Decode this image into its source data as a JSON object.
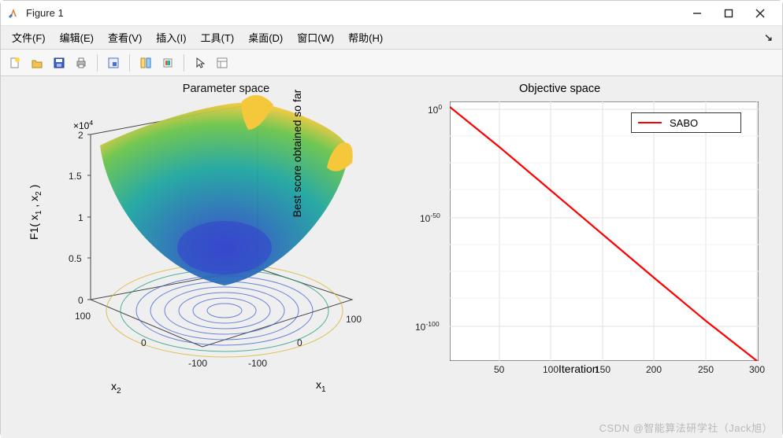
{
  "window": {
    "title": "Figure 1",
    "min_tip": "Minimize",
    "max_tip": "Maximize",
    "close_tip": "Close"
  },
  "menu": {
    "file": "文件(F)",
    "edit": "编辑(E)",
    "view": "查看(V)",
    "insert": "插入(I)",
    "tools": "工具(T)",
    "desktop": "桌面(D)",
    "window": "窗口(W)",
    "help": "帮助(H)"
  },
  "toolbar": {
    "new": "New Figure",
    "open": "Open",
    "save": "Save",
    "print": "Print",
    "data_cursor": "Data Cursor",
    "link": "Link Plot",
    "colorbar": "Insert Colorbar",
    "legend": "Insert Legend",
    "edit_plot": "Edit Plot",
    "open_pe": "Open Property Inspector"
  },
  "chart_data": [
    {
      "type": "surface3d",
      "title": "Parameter space",
      "z_exponent_label": "×10^4",
      "zlabel": "F1( x_1 , x_2 )",
      "xlabel": "x_1",
      "ylabel": "x_2",
      "x_range": [
        -100,
        100
      ],
      "y_range": [
        -100,
        100
      ],
      "z_range": [
        0,
        20000
      ],
      "x_ticks": [
        -100,
        0,
        100
      ],
      "y_ticks": [
        -100,
        0,
        100
      ],
      "z_ticks_scaled": [
        0,
        0.5,
        1,
        1.5,
        2
      ],
      "function": "F1(x1,x2) = x1^2 + x2^2 (sphere benchmark, scaled ×10^4)",
      "sample_values": [
        {
          "x1": -100,
          "x2": -100,
          "F1": 20000
        },
        {
          "x1": -100,
          "x2": 0,
          "F1": 10000
        },
        {
          "x1": 0,
          "x2": 0,
          "F1": 0
        },
        {
          "x1": 100,
          "x2": 0,
          "F1": 10000
        },
        {
          "x1": 100,
          "x2": 100,
          "F1": 20000
        }
      ],
      "contour_shown": true
    },
    {
      "type": "line",
      "title": "Objective space",
      "xlabel": "Iteration",
      "ylabel": "Best score obtained so far",
      "x_ticks": [
        50,
        100,
        150,
        200,
        250,
        300
      ],
      "y_ticks_label": [
        "10^0",
        "10^-50",
        "10^-100"
      ],
      "y_scale": "log",
      "y_range_log10": [
        0,
        -120
      ],
      "x_range": [
        1,
        300
      ],
      "legend_position": "northeast",
      "series": [
        {
          "name": "SABO",
          "color": "#ff0000",
          "linewidth": 2,
          "x": [
            1,
            50,
            100,
            150,
            200,
            250,
            300
          ],
          "y_log10": [
            1,
            -18,
            -38,
            -58,
            -78,
            -98,
            -118
          ]
        }
      ],
      "grid": true
    }
  ],
  "watermark": "CSDN @智能算法研学社（Jack旭）"
}
